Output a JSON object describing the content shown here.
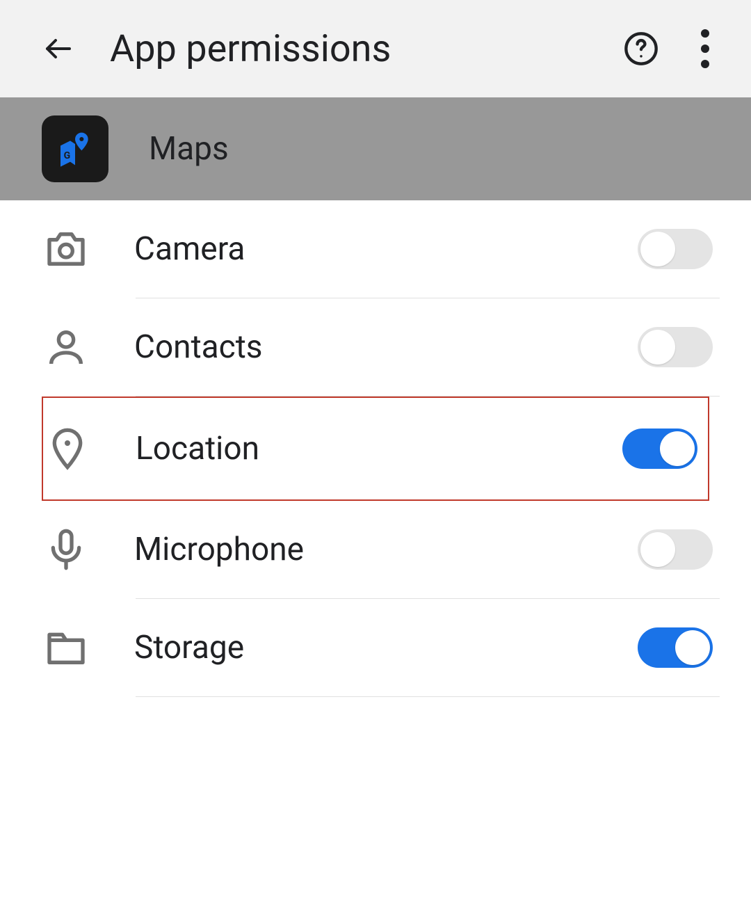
{
  "header": {
    "title": "App permissions"
  },
  "app": {
    "name": "Maps"
  },
  "permissions": [
    {
      "id": "camera",
      "label": "Camera",
      "enabled": false,
      "highlighted": false
    },
    {
      "id": "contacts",
      "label": "Contacts",
      "enabled": false,
      "highlighted": false
    },
    {
      "id": "location",
      "label": "Location",
      "enabled": true,
      "highlighted": true
    },
    {
      "id": "microphone",
      "label": "Microphone",
      "enabled": false,
      "highlighted": false
    },
    {
      "id": "storage",
      "label": "Storage",
      "enabled": true,
      "highlighted": false
    }
  ],
  "colors": {
    "accent": "#1a73e8",
    "highlight_border": "#c0392b"
  }
}
